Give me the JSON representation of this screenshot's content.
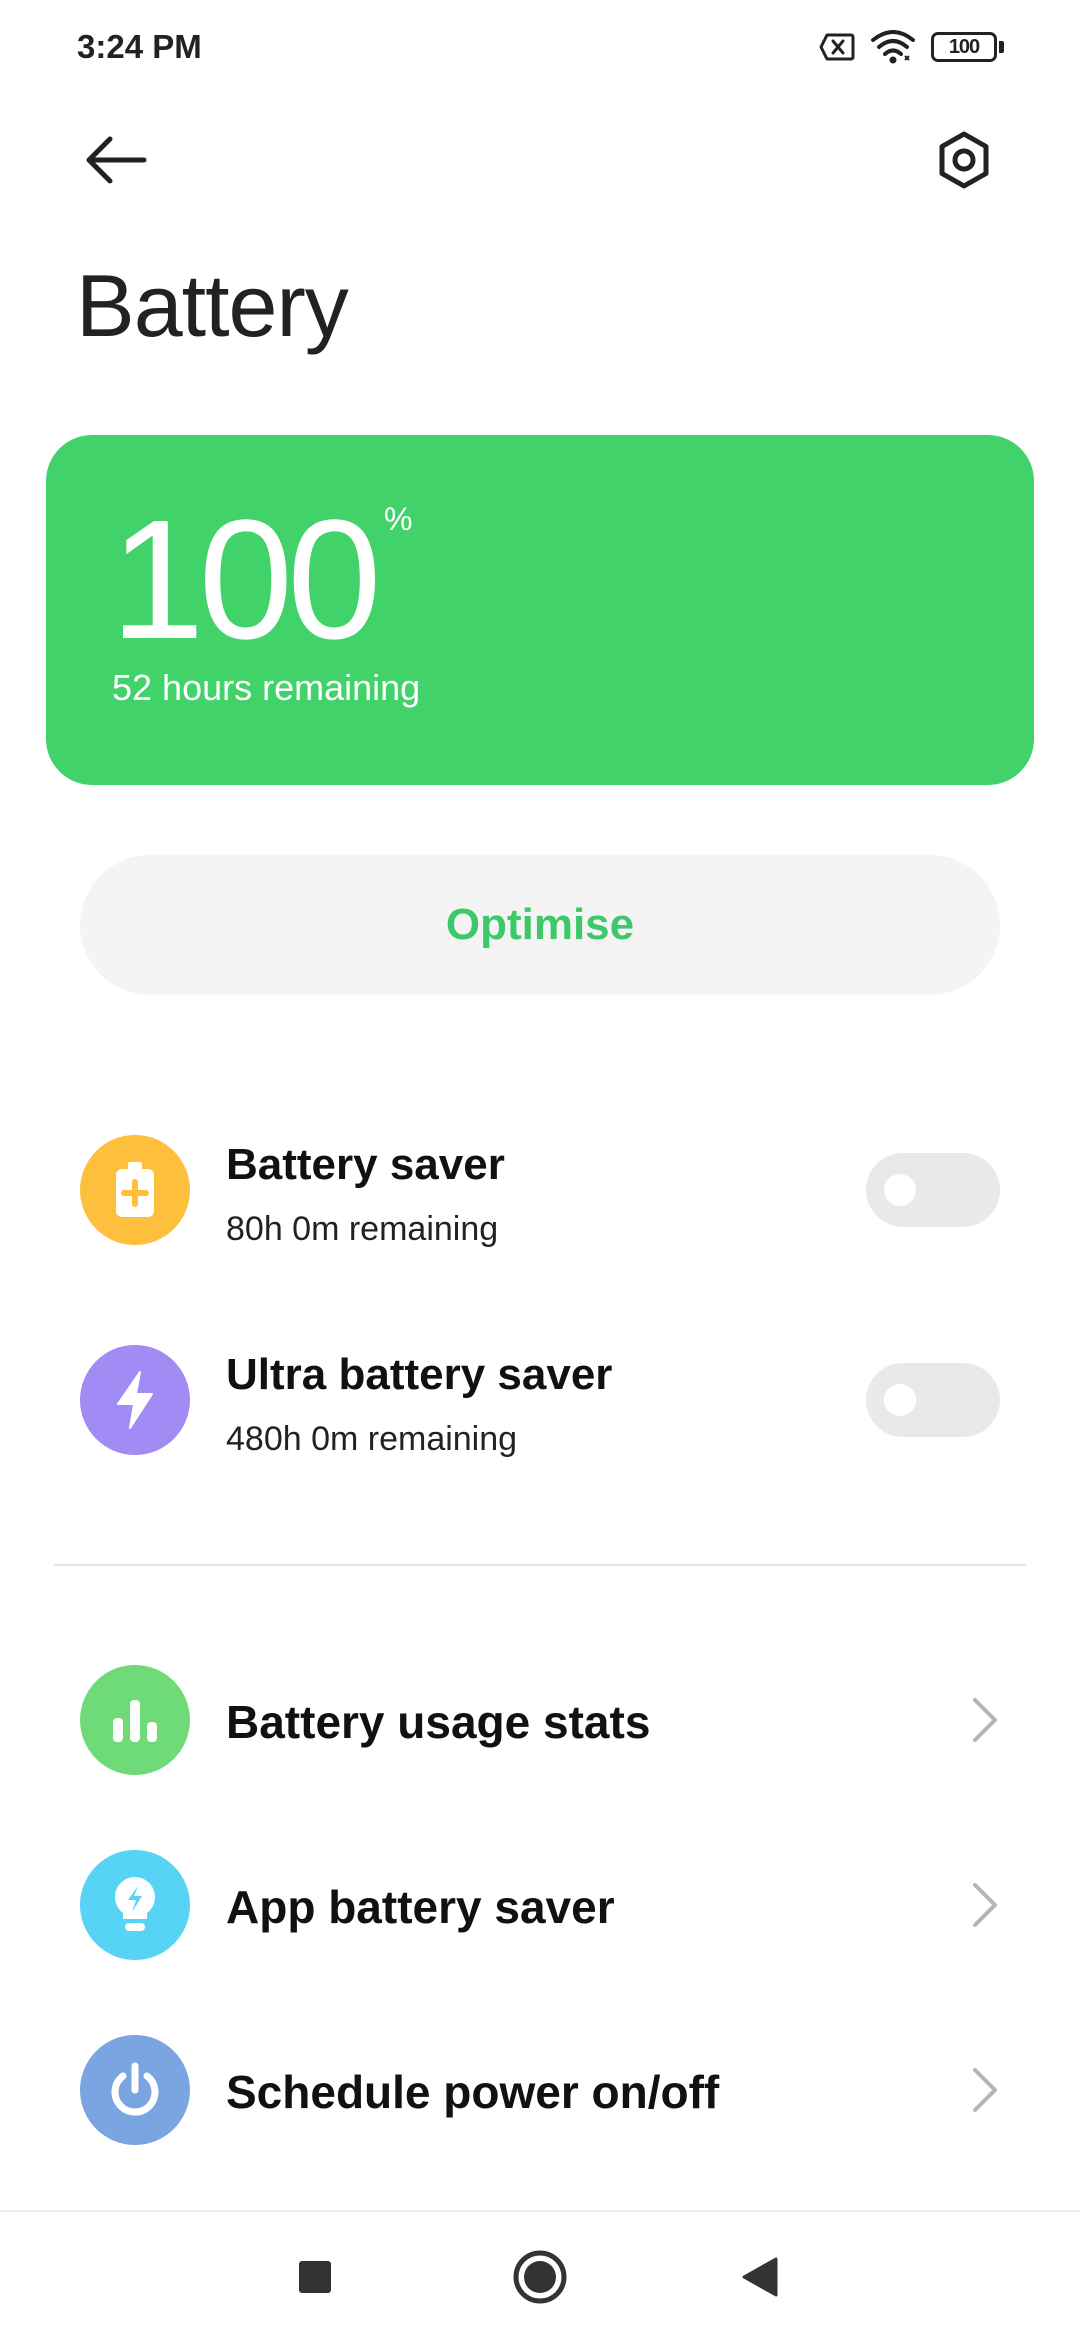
{
  "status_bar": {
    "time": "3:24 PM",
    "battery_level": "100",
    "icons": [
      "no-sim-icon",
      "wifi-icon",
      "battery-icon"
    ]
  },
  "header": {
    "title": "Battery",
    "back_icon": "arrow-left-icon",
    "settings_icon": "hexagon-settings-icon"
  },
  "battery_card": {
    "level": "100",
    "unit": "%",
    "remaining": "52 hours remaining",
    "color": "#42d26a"
  },
  "optimise": {
    "label": "Optimise",
    "color": "#3fc86a"
  },
  "savers": [
    {
      "title": "Battery saver",
      "subtitle": "80h 0m remaining",
      "icon": "battery-plus-icon",
      "icon_color": "#fdbf3c",
      "enabled": false
    },
    {
      "title": "Ultra battery saver",
      "subtitle": "480h 0m remaining",
      "icon": "lightning-icon",
      "icon_color": "#a18cf5",
      "enabled": false
    }
  ],
  "menu": [
    {
      "title": "Battery usage stats",
      "icon": "bar-chart-icon",
      "icon_color": "#6edb78"
    },
    {
      "title": "App battery saver",
      "icon": "lightbulb-icon",
      "icon_color": "#57d3f5"
    },
    {
      "title": "Schedule power on/off",
      "icon": "power-icon",
      "icon_color": "#7ba5e0"
    }
  ],
  "nav_bar": {
    "buttons": [
      "recents-icon",
      "home-icon",
      "back-triangle-icon"
    ]
  }
}
